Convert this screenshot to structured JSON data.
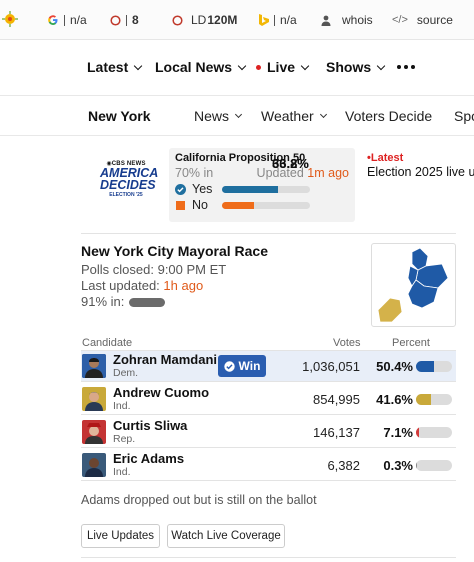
{
  "seo_bar": {
    "items": [
      {
        "icon": "google-g-icon",
        "value": "n/a"
      },
      {
        "icon": "circle-o-icon",
        "value": "8"
      },
      {
        "icon": "circle-o-icon",
        "prefix": "LD",
        "value": "120M"
      },
      {
        "icon": "bing-icon",
        "value": "n/a"
      },
      {
        "icon": "person-icon",
        "value": "whois"
      },
      {
        "icon": "code-icon",
        "value": "source"
      }
    ]
  },
  "nav_primary": {
    "items": [
      "Latest",
      "Local News",
      "Live",
      "Shows"
    ]
  },
  "nav_secondary": {
    "items": [
      "New York",
      "News",
      "Weather",
      "Voters Decide",
      "Spo"
    ]
  },
  "logo": {
    "line1": "CBS NEWS",
    "line2": "AMERICA",
    "line3": "DECIDES",
    "line4": "ELECTION '25"
  },
  "prop50": {
    "title": "California Proposition 50",
    "reporting": "70% in",
    "updated_label": "Updated",
    "updated_ago": "1m ago",
    "yes_label": "Yes",
    "yes_pct": "63.8%",
    "yes_share": 63.8,
    "no_label": "No",
    "no_pct": "36.2%",
    "no_share": 36.2
  },
  "latest": {
    "label": "Latest",
    "text": "Election 2025 live u"
  },
  "race": {
    "title": "New York City Mayoral Race",
    "polls": "Polls closed: 9:00 PM ET",
    "updated_label": "Last updated:",
    "updated_ago": "1h ago",
    "reporting": "91% in:",
    "col_candidate": "Candidate",
    "col_votes": "Votes",
    "col_percent": "Percent",
    "win_label": "Win",
    "candidates": [
      {
        "name": "Zohran Mamdani",
        "party": "Dem.",
        "votes": "1,036,051",
        "pct": "50.4%",
        "share": 50.4,
        "color": "#1f5aa6",
        "winner": true
      },
      {
        "name": "Andrew Cuomo",
        "party": "Ind.",
        "votes": "854,995",
        "pct": "41.6%",
        "share": 41.6,
        "color": "#c9a93a",
        "winner": false
      },
      {
        "name": "Curtis Sliwa",
        "party": "Rep.",
        "votes": "146,137",
        "pct": "7.1%",
        "share": 7.1,
        "color": "#d23a3a",
        "winner": false
      },
      {
        "name": "Eric Adams",
        "party": "Ind.",
        "votes": "6,382",
        "pct": "0.3%",
        "share": 0.3,
        "color": "#8a8a8a",
        "winner": false
      }
    ],
    "note": "Adams dropped out but is still on the ballot",
    "btn_updates": "Live Updates",
    "btn_watch": "Watch Live Coverage"
  },
  "colors": {
    "yes": "#1f6f9f",
    "no": "#ef6c1a",
    "accent_red": "#dd2222",
    "link_orange": "#e05a1a",
    "dem_blue": "#1f5aa6"
  }
}
